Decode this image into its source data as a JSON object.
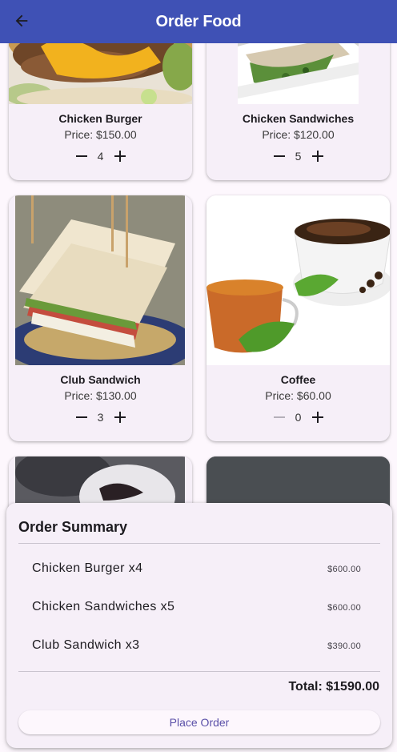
{
  "appbar": {
    "title": "Order Food",
    "back_icon": "arrow-back-icon"
  },
  "menu": {
    "items": [
      {
        "name": "Chicken Burger",
        "price": "Price: $150.00",
        "qty": "4"
      },
      {
        "name": "Chicken Sandwiches",
        "price": "Price: $120.00",
        "qty": "5"
      },
      {
        "name": "Club Sandwich",
        "price": "Price: $130.00",
        "qty": "3"
      },
      {
        "name": "Coffee",
        "price": "Price: $60.00",
        "qty": "0"
      }
    ]
  },
  "summary": {
    "title": "Order Summary",
    "lines": [
      {
        "label": "Chicken Burger x4",
        "amount": "$600.00"
      },
      {
        "label": "Chicken Sandwiches x5",
        "amount": "$600.00"
      },
      {
        "label": "Club Sandwich x3",
        "amount": "$390.00"
      }
    ],
    "total": "Total: $1590.00",
    "place_order": "Place Order"
  },
  "colors": {
    "primary": "#3f51b5",
    "surface": "#f6eff8",
    "background": "#fdf7fd",
    "button_text": "#5a4fa8"
  }
}
